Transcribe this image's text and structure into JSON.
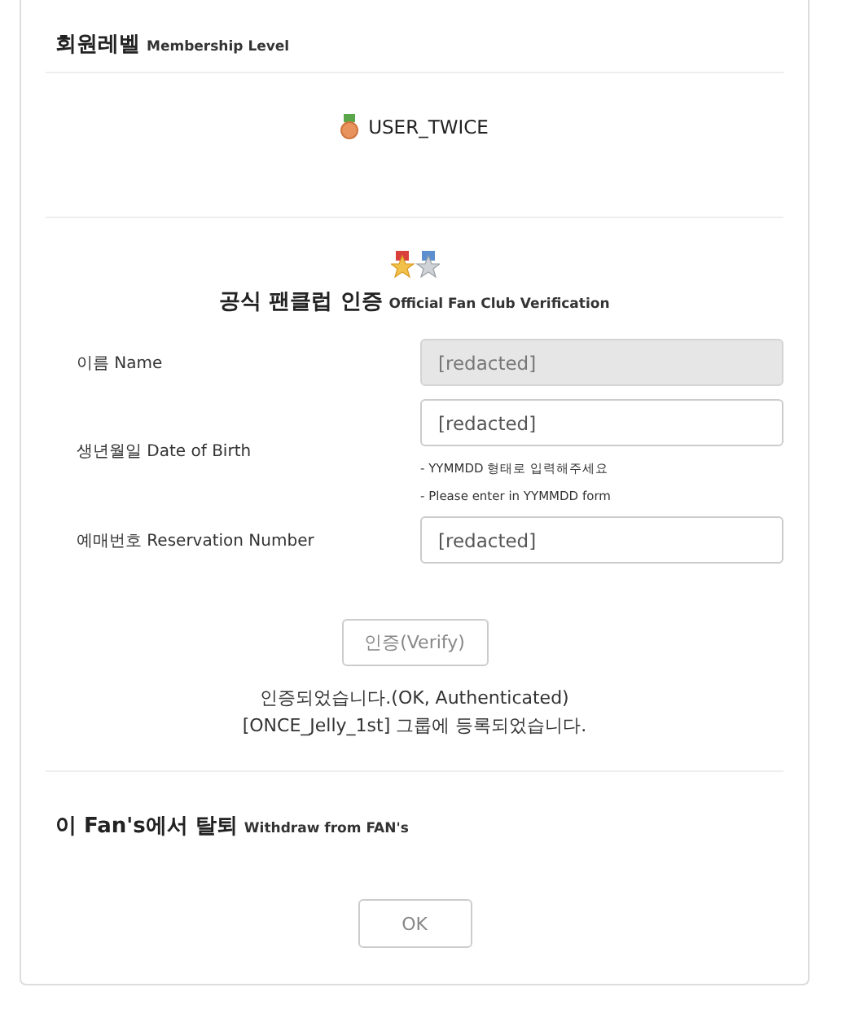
{
  "membership": {
    "heading": "회원레벨",
    "heading_en": "Membership Level",
    "level_name": "USER_TWICE"
  },
  "verification": {
    "heading": "공식 팬클럽 인증",
    "heading_en": "Official Fan Club Verification",
    "fields": [
      {
        "label": "이름 Name",
        "value": "[redacted]",
        "disabled": true
      },
      {
        "label": "생년월일 Date of Birth",
        "value": "[redacted]",
        "disabled": false,
        "hints": [
          "- YYMMDD 형태로 입력해주세요",
          "- Please enter in YYMMDD form"
        ]
      },
      {
        "label": "예매번호 Reservation Number",
        "value": "[redacted]",
        "disabled": false
      }
    ],
    "button": "인증(Verify)",
    "messages": [
      "인증되었습니다.(OK, Authenticated)",
      "[ONCE_Jelly_1st] 그룹에 등록되었습니다."
    ]
  },
  "withdraw": {
    "heading": "이 Fan's에서 탈퇴",
    "heading_en": "Withdraw from FAN's",
    "button": "OK"
  }
}
